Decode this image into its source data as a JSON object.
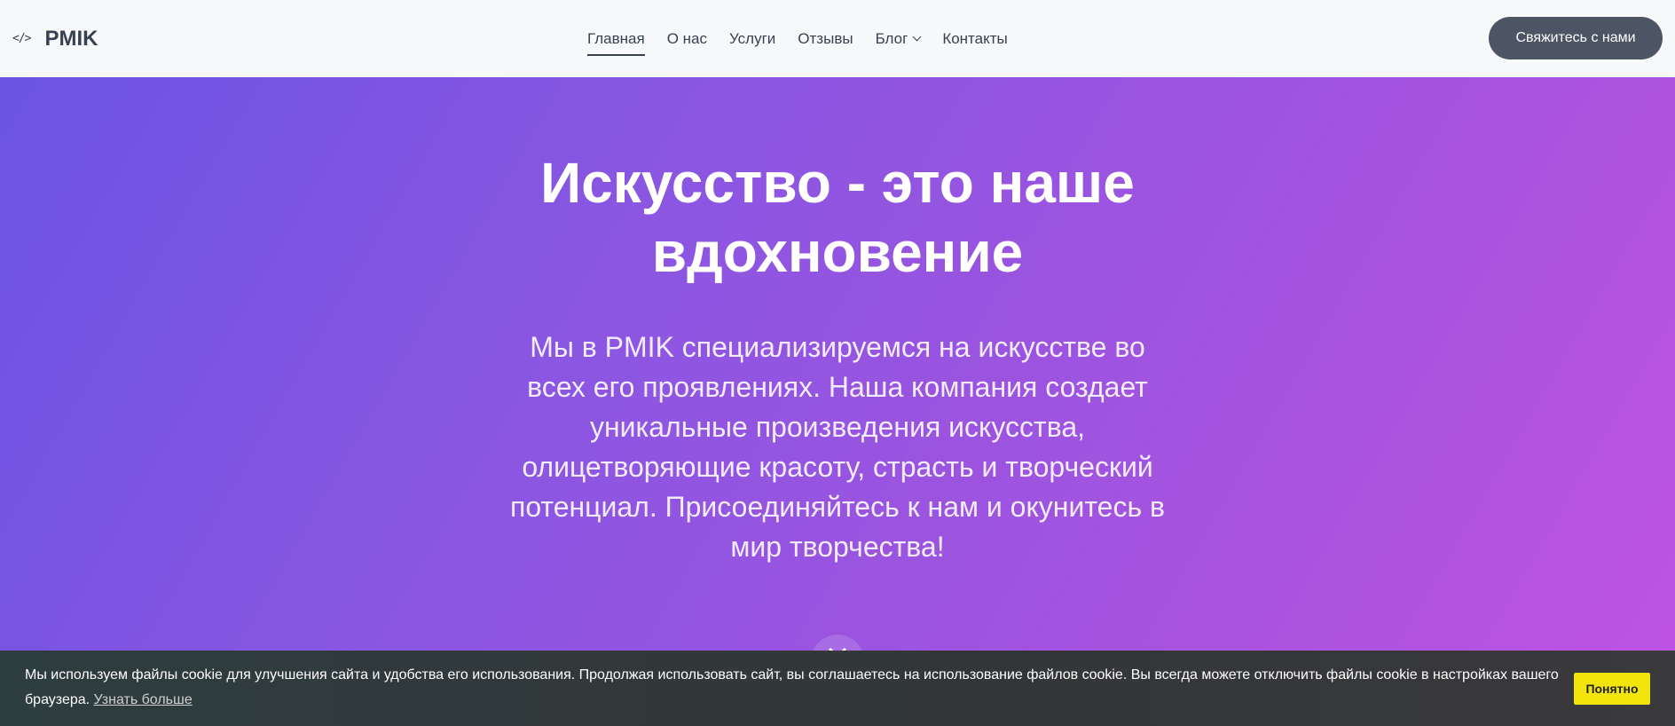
{
  "header": {
    "logo_icon": "</>",
    "logo_text": "PMIK",
    "nav": [
      {
        "label": "Главная",
        "active": true
      },
      {
        "label": "О нас"
      },
      {
        "label": "Услуги"
      },
      {
        "label": "Отзывы"
      },
      {
        "label": "Блог",
        "has_dropdown": true
      },
      {
        "label": "Контакты"
      }
    ],
    "cta_label": "Свяжитесь с нами"
  },
  "hero": {
    "title": "Искусство - это наше вдохновение",
    "text": "Мы в PMIK специализируемся на искусстве во всех его проявлениях. Наша компания создает уникальные произведения искусства, олицетворяющие красоту, страсть и творческий потенциал. Присоединяйтесь к нам и окунитесь в мир творчества!",
    "gradient_start": "#6b54e3",
    "gradient_end": "#c053e3"
  },
  "cookie": {
    "text": "Мы используем файлы cookie для улучшения сайта и удобства его использования. Продолжая использовать сайт, вы соглашаетесь на использование файлов cookie. Вы всегда можете отключить файлы cookie в настройках вашего браузера.",
    "link_label": "Узнать больше",
    "button_label": "Понятно",
    "button_color": "#f1e50c"
  }
}
